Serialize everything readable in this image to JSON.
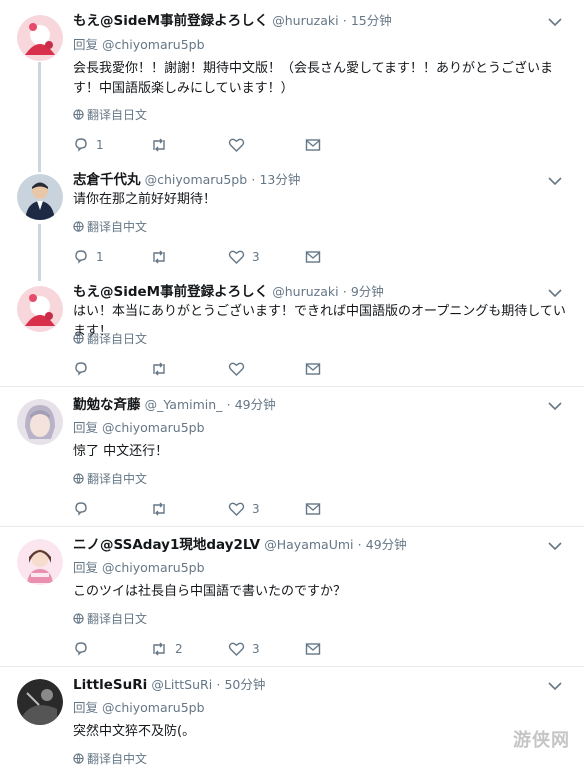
{
  "labels": {
    "reply_to_prefix": "回复 ",
    "translate_jp": "翻译自日文",
    "translate_zh": "翻译自中文"
  },
  "tweets": [
    {
      "display_name": "もえ@SideM事前登録よろしく",
      "handle": "@huruzaki",
      "time": "15分钟",
      "reply_to": "@chiyomaru5pb",
      "text": "会長我愛你！！謝謝！期待中文版！（会長さん愛してます！！ありがとうございます！中国語版楽しみにしています！）",
      "translate": "翻译自日文",
      "reply_count": "1",
      "retweet_count": "",
      "like_count": ""
    },
    {
      "display_name": "志倉千代丸",
      "handle": "@chiyomaru5pb",
      "time": "13分钟",
      "reply_to": "",
      "text": "请你在那之前好好期待！",
      "translate": "翻译自中文",
      "reply_count": "1",
      "retweet_count": "",
      "like_count": "3"
    },
    {
      "display_name": "もえ@SideM事前登録よろしく",
      "handle": "@huruzaki",
      "time": "9分钟",
      "reply_to": "",
      "text": "はい！本当にありがとうございます！できれば中国語版のオープニングも期待しています！",
      "translate": "翻译自日文",
      "reply_count": "",
      "retweet_count": "",
      "like_count": ""
    },
    {
      "display_name": "勤勉な斉藤",
      "handle": "@_Yamimin_",
      "time": "49分钟",
      "reply_to": "@chiyomaru5pb",
      "text": "惊了 中文还行！",
      "translate": "翻译自中文",
      "reply_count": "",
      "retweet_count": "",
      "like_count": "3"
    },
    {
      "display_name": "ニノ@SSAday1現地day2LV",
      "handle": "@HayamaUmi",
      "time": "49分钟",
      "reply_to": "@chiyomaru5pb",
      "text": "このツイは社長自ら中国語で書いたのですか？",
      "translate": "翻译自日文",
      "reply_count": "",
      "retweet_count": "2",
      "like_count": "3"
    },
    {
      "display_name": "LittleSuRi",
      "handle": "@LittSuRi",
      "time": "50分钟",
      "reply_to": "@chiyomaru5pb",
      "text": "突然中文猝不及防(。",
      "translate": "翻译自中文",
      "reply_count": "",
      "retweet_count": "",
      "like_count": ""
    }
  ],
  "watermark": "游侠网",
  "colors": {
    "text": "#14171a",
    "secondary": "#657786",
    "divider": "#e6ecf0",
    "thread": "#ccd6dd"
  }
}
